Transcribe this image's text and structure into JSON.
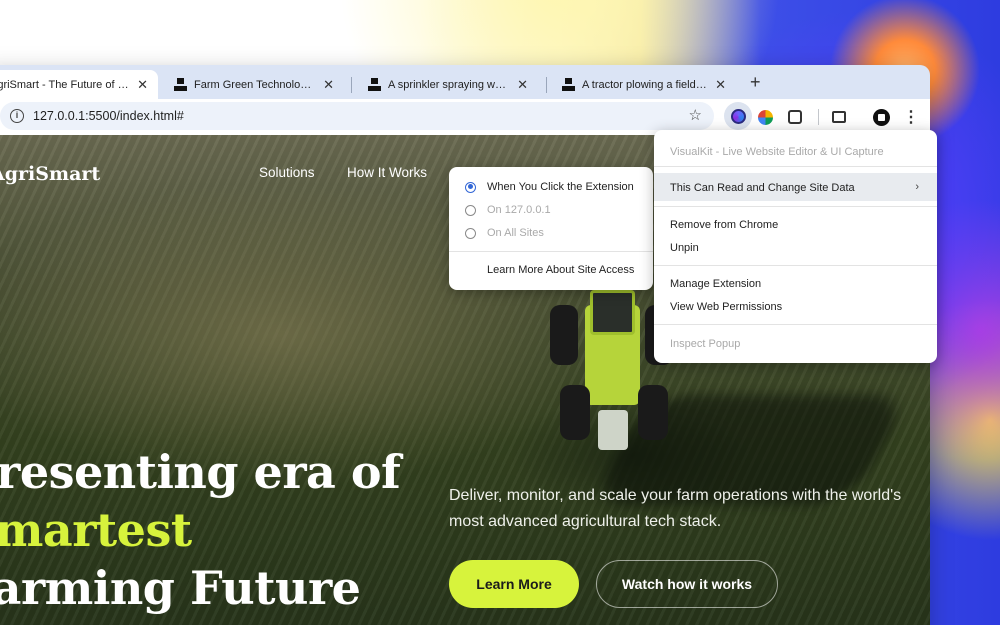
{
  "tabs": [
    {
      "title": "AgriSmart - The Future of Smart Farming",
      "active": true
    },
    {
      "title": "Farm Green Technology Pictures"
    },
    {
      "title": "A sprinkler spraying water on crops"
    },
    {
      "title": "A tractor plowing a field at sunset"
    }
  ],
  "new_tab_label": "+",
  "url": "127.0.0.1:5500/index.html#",
  "site": {
    "logo": "AgriSmart",
    "nav": [
      "Solutions",
      "How It Works"
    ],
    "headline": [
      "Presenting era of",
      "Smartest",
      "Farming Future"
    ],
    "subtitle": "Deliver, monitor, and scale your farm operations with the world's most advanced agricultural tech stack.",
    "learn_more": "Learn More",
    "watch": "Watch how it works"
  },
  "site_access_menu": {
    "options": [
      {
        "label": "When You Click the Extension",
        "selected": true,
        "enabled": true
      },
      {
        "label": "On 127.0.0.1",
        "selected": false,
        "enabled": false
      },
      {
        "label": "On All Sites",
        "selected": false,
        "enabled": false
      }
    ],
    "learn_more": "Learn More About Site Access"
  },
  "extension_menu": {
    "title": "VisualKit - Live Website Editor & UI Capture",
    "site_data": "This Can Read and Change Site Data",
    "remove": "Remove from Chrome",
    "unpin": "Unpin",
    "manage": "Manage Extension",
    "permissions": "View Web Permissions",
    "inspect": "Inspect Popup"
  },
  "colors": {
    "accent_lime": "#d7f33c",
    "radio_blue": "#3367d6"
  }
}
